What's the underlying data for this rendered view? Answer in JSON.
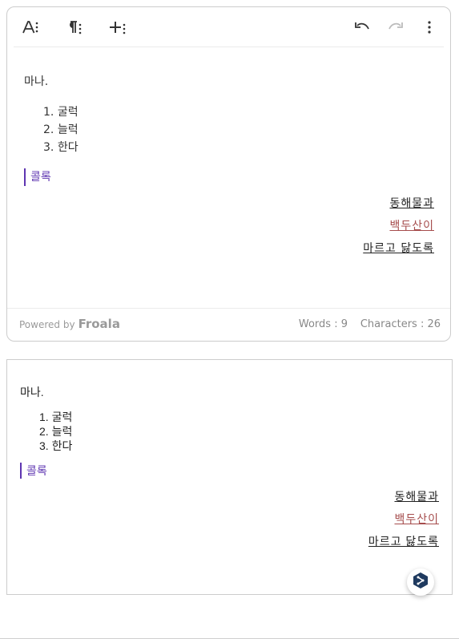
{
  "toolbar": {
    "buttons": [
      {
        "name": "text-format",
        "icon": "text-format-icon"
      },
      {
        "name": "paragraph-format",
        "icon": "paragraph-icon"
      },
      {
        "name": "insert-more",
        "icon": "plus-more-icon"
      },
      {
        "name": "undo",
        "icon": "undo-icon"
      },
      {
        "name": "redo",
        "icon": "redo-icon",
        "disabled": true
      },
      {
        "name": "more",
        "icon": "more-vertical-icon"
      }
    ]
  },
  "editor": {
    "paragraph": "마나.",
    "list": [
      "굴럭",
      "늘럭",
      "한다"
    ],
    "quote": "콜록",
    "right_lines": [
      {
        "text": "동해물과",
        "color": "#222222"
      },
      {
        "text": "백두산이",
        "color": "#a64d4d"
      },
      {
        "text": "마르고 닳도록",
        "color": "#222222"
      }
    ]
  },
  "footer": {
    "powered_by": "Powered by",
    "brand": "Froala",
    "words": "Words : 9",
    "characters": "Characters : 26"
  },
  "preview": {
    "paragraph": "마나.",
    "list": [
      "굴럭",
      "늘럭",
      "한다"
    ],
    "quote": "콜록",
    "right_lines": [
      "동해물과",
      "백두산이",
      "마르고 닳도록"
    ]
  },
  "colors": {
    "accent": "#5e35b1",
    "red_text": "#a64d4d",
    "border": "#cccccc"
  },
  "fab": {
    "icon": "share-icon"
  }
}
